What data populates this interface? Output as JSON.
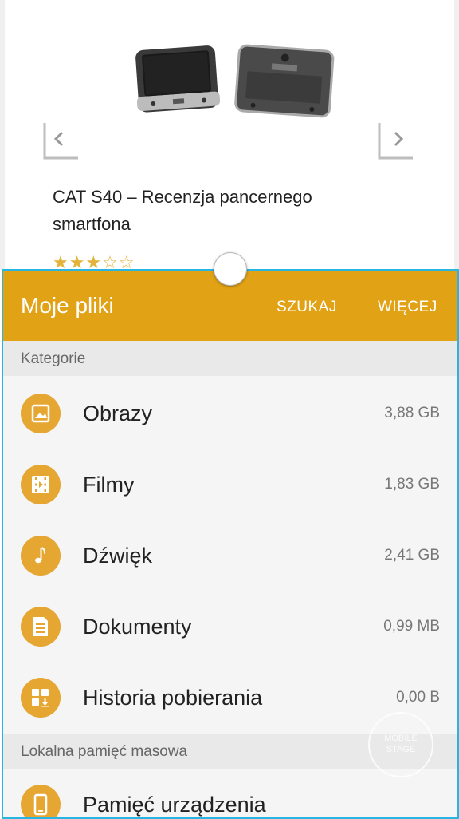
{
  "article": {
    "title": "CAT S40 – Recenzja pancernego smartfona",
    "rating_stars": "★★★☆☆",
    "rating_value": 3
  },
  "app": {
    "title": "Moje pliki",
    "actions": {
      "search": "SZUKAJ",
      "more": "WIĘCEJ"
    },
    "accent_color": "#e1a216",
    "frame_color": "#27b5e1"
  },
  "sections": {
    "categories": "Kategorie",
    "local": "Lokalna pamięć masowa"
  },
  "categories": [
    {
      "label": "Obrazy",
      "size": "3,88 GB",
      "icon": "image-icon"
    },
    {
      "label": "Filmy",
      "size": "1,83 GB",
      "icon": "film-icon"
    },
    {
      "label": "Dźwięk",
      "size": "2,41 GB",
      "icon": "music-note-icon"
    },
    {
      "label": "Dokumenty",
      "size": "0,99 MB",
      "icon": "document-icon"
    },
    {
      "label": "Historia pobierania",
      "size": "0,00 B",
      "icon": "download-history-icon"
    }
  ],
  "storage": [
    {
      "label": "Pamięć urządzenia",
      "icon": "phone-storage-icon"
    }
  ]
}
